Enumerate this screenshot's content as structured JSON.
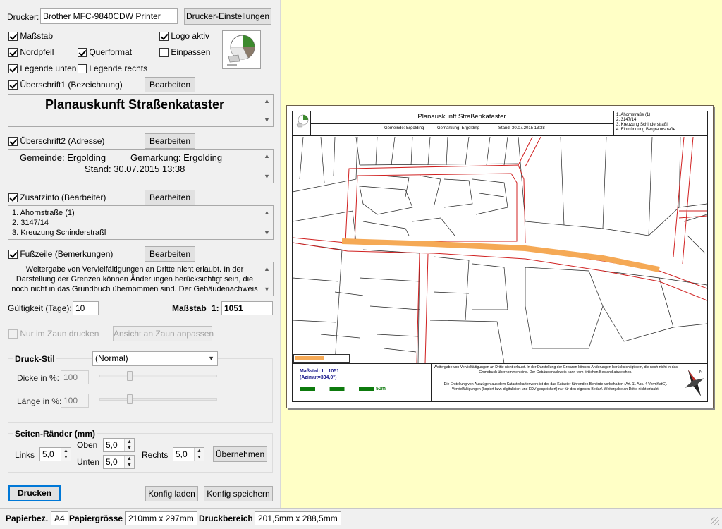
{
  "printer": {
    "label": "Drucker:",
    "value": "Brother MFC-9840CDW Printer",
    "settings_button": "Drucker-Einstellungen"
  },
  "options": {
    "scale": {
      "label": "Maßstab",
      "checked": true
    },
    "logo": {
      "label": "Logo aktiv",
      "checked": true
    },
    "north_arrow": {
      "label": "Nordpfeil",
      "checked": true
    },
    "landscape": {
      "label": "Querformat",
      "checked": true
    },
    "fit": {
      "label": "Einpassen",
      "checked": false
    },
    "legend_bottom": {
      "label": "Legende unten",
      "checked": true
    },
    "legend_right": {
      "label": "Legende rechts",
      "checked": false
    }
  },
  "heading1": {
    "label": "Überschrift1 (Bezeichnung)",
    "checked": true,
    "edit_button": "Bearbeiten",
    "text": "Planauskunft Straßenkataster"
  },
  "heading2": {
    "label": "Überschrift2 (Adresse)",
    "checked": true,
    "edit_button": "Bearbeiten",
    "line1_a": "Gemeinde: Ergolding",
    "line1_b": "Gemarkung: Ergolding",
    "line2": "Stand: 30.07.2015 13:38"
  },
  "extra_info": {
    "label": "Zusatzinfo (Bearbeiter)",
    "checked": true,
    "edit_button": "Bearbeiten",
    "lines": [
      "1. Ahornstraße (1)",
      "2. 3147/14",
      "3. Kreuzung Schinderstraßl"
    ]
  },
  "footer": {
    "label": "Fußzeile (Bemerkungen)",
    "checked": true,
    "edit_button": "Bearbeiten",
    "lines": [
      "Weitergabe von Vervielfältigungen an Dritte nicht erlaubt. In der",
      "Darstellung der Grenzen können Änderungen berücksichtigt sein, die",
      "noch nicht in das Grundbuch übernommen sind. Der Gebäudenachweis"
    ]
  },
  "validity": {
    "label": "Gültigkeit (Tage):",
    "value": "10"
  },
  "scale_field": {
    "label": "Maßstab",
    "prefix": "1:",
    "value": "1051"
  },
  "fence": {
    "only_in_fence": "Nur im Zaun drucken",
    "fit_to_fence": "Ansicht an Zaun anpassen"
  },
  "print_style": {
    "title": "Druck-Stil",
    "selected": "(Normal)",
    "thickness_label": "Dicke in %:",
    "thickness_value": "100",
    "length_label": "Länge in %:",
    "length_value": "100"
  },
  "margins": {
    "title": "Seiten-Ränder (mm)",
    "left_label": "Links",
    "left_value": "5,0",
    "top_label": "Oben",
    "top_value": "5,0",
    "bottom_label": "Unten",
    "bottom_value": "5,0",
    "right_label": "Rechts",
    "right_value": "5,0",
    "apply_button": "Übernehmen"
  },
  "actions": {
    "print": "Drucken",
    "load_config": "Konfig laden",
    "save_config": "Konfig speichern"
  },
  "status": {
    "paper_label": "Papierbez.",
    "paper_value": "A4",
    "size_label": "Papiergrösse",
    "size_value": "210mm x 297mm",
    "area_label": "Druckbereich",
    "area_value": "201,5mm x 288,5mm"
  },
  "preview": {
    "title": "Planauskunft Straßenkataster",
    "sub_gemeinde": "Gemeinde: Ergolding",
    "sub_gemarkung": "Gemarkung: Ergolding",
    "sub_stand": "Stand: 30.07.2015 13:38",
    "info_lines": [
      "1. Ahornstraße (1)",
      "2. 3147/14",
      "3. Kreuzung Schinderstraßl",
      "4. Einmündung Bergratorstraße"
    ],
    "scale_line1": "Maßstab 1 : 1051",
    "scale_line2": "(Azimut=334,0°)",
    "scale_bar_label": "50m",
    "footer_text1": "Weitergabe von Vervielfältigungen an Dritte nicht erlaubt. In der Darstellung der Grenzen können Änderungen berücksichtigt sein, die noch nicht in das Grundbuch übernommen sind. Der Gebäudenachweis kann vom örtlichen Bestand abweichen.",
    "footer_text2": "Die Erstellung von Auszügen aus dem Katasterkartenwerk ist der das Kataster führenden Behörde vorbehalten (Art. 11 Abs. 4 VermKatG). Vervielfältigungen (kopiert bzw. digitalisiert und EDV gespeichert) nur für den eigenen Bedarf. Weitergabe an Dritte nicht erlaubt."
  },
  "colors": {
    "road_highlight": "#f5a955",
    "parcel_boundary": "#d02020",
    "scale_text": "#1a1a8c",
    "scale_bar": "#0d7a0d",
    "preview_background": "#ffffc6"
  }
}
